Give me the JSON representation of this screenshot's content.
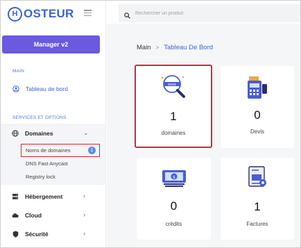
{
  "brand": {
    "logo_letter": "H",
    "name": "OSTEUR"
  },
  "sidebar": {
    "manager_label": "Manager v2",
    "section_main": "MAIN",
    "dashboard_label": "Tableau de bord",
    "section_services": "SERVICES ET OPTIONS",
    "domaines_label": "Domaines",
    "sub_items": [
      "Noms de domaines",
      "DNS Fast Anycast",
      "Registry lock"
    ],
    "badge_count": "1",
    "hebergement_label": "Hébergement",
    "cloud_label": "Cloud",
    "securite_label": "Sécurité"
  },
  "search": {
    "placeholder": "Rechercher un produit"
  },
  "breadcrumb": {
    "root": "Main",
    "separator": ">",
    "current": "Tableau De Bord"
  },
  "cards": [
    {
      "count": "1",
      "label": "domaines",
      "icon": "www-search-icon"
    },
    {
      "count": "0",
      "label": "Devis",
      "icon": "payment-terminal-icon"
    },
    {
      "count": "0",
      "label": "crédits",
      "icon": "cash-icon"
    },
    {
      "count": "1",
      "label": "Factures",
      "icon": "invoice-icon"
    }
  ],
  "colors": {
    "accent": "#3b63d8",
    "manager": "#6a5ae0",
    "highlight": "#d9242b",
    "badge": "#5b8fe8"
  }
}
